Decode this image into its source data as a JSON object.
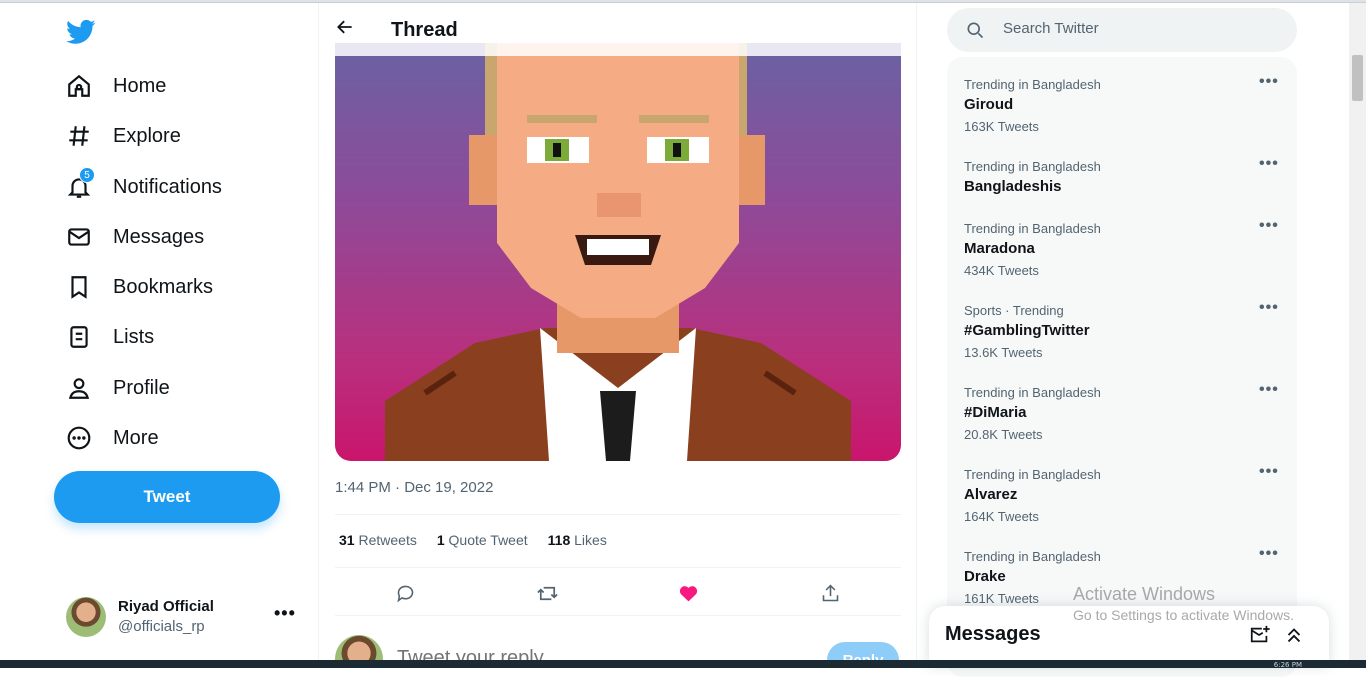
{
  "sidebar": {
    "nav": [
      {
        "label": "Home",
        "icon": "home-icon"
      },
      {
        "label": "Explore",
        "icon": "hashtag-icon"
      },
      {
        "label": "Notifications",
        "icon": "bell-icon",
        "badge": "5"
      },
      {
        "label": "Messages",
        "icon": "envelope-icon"
      },
      {
        "label": "Bookmarks",
        "icon": "bookmark-icon"
      },
      {
        "label": "Lists",
        "icon": "list-icon"
      },
      {
        "label": "Profile",
        "icon": "person-icon"
      },
      {
        "label": "More",
        "icon": "more-circle-icon"
      }
    ],
    "tweet_button": "Tweet",
    "account": {
      "name": "Riyad Official",
      "handle": "@officials_rp",
      "more": "•••"
    }
  },
  "main": {
    "title": "Thread",
    "timestamp": "1:44 PM · Dec 19, 2022",
    "stats": {
      "retweets_count": "31",
      "retweets_label": "Retweets",
      "quotes_count": "1",
      "quotes_label": "Quote Tweet",
      "likes_count": "118",
      "likes_label": "Likes"
    },
    "reply": {
      "placeholder": "Tweet your reply",
      "button": "Reply"
    }
  },
  "search": {
    "placeholder": "Search Twitter"
  },
  "trends": [
    {
      "context": "Trending in Bangladesh",
      "name": "Giroud",
      "count": "163K Tweets"
    },
    {
      "context": "Trending in Bangladesh",
      "name": "Bangladeshis",
      "count": ""
    },
    {
      "context": "Trending in Bangladesh",
      "name": "Maradona",
      "count": "434K Tweets"
    },
    {
      "context": "Sports · Trending",
      "name": "#GamblingTwitter",
      "count": "13.6K Tweets"
    },
    {
      "context": "Trending in Bangladesh",
      "name": "#DiMaria",
      "count": "20.8K Tweets"
    },
    {
      "context": "Trending in Bangladesh",
      "name": "Alvarez",
      "count": "164K Tweets"
    },
    {
      "context": "Trending in Bangladesh",
      "name": "Drake",
      "count": "161K Tweets"
    }
  ],
  "trend_more": "•••",
  "messages_drawer": {
    "title": "Messages"
  },
  "watermark": {
    "title": "Activate Windows",
    "subtitle": "Go to Settings to activate Windows."
  },
  "taskbar": {
    "time": "6:26 PM"
  },
  "colors": {
    "accent": "#1d9bf0",
    "like": "#f91880",
    "text": "#0f1419",
    "muted": "#536471"
  }
}
